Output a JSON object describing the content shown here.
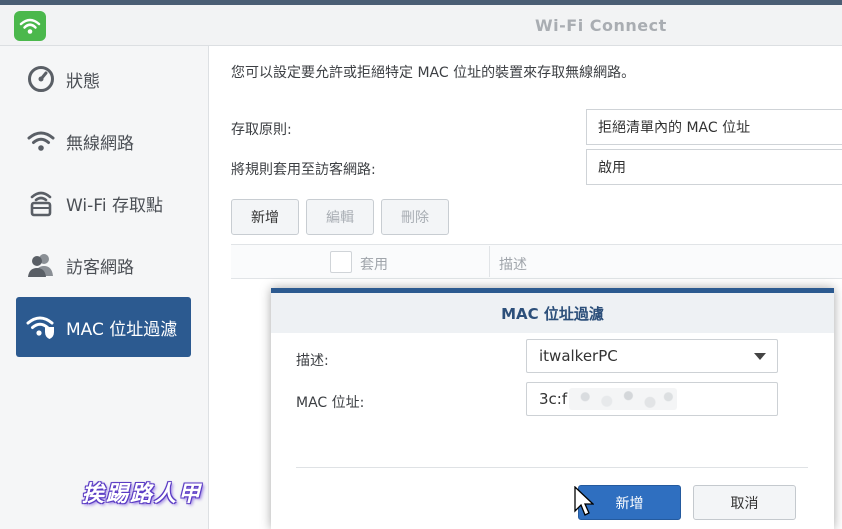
{
  "window": {
    "title": "Wi-Fi Connect"
  },
  "colors": {
    "accent": "#2c5a90",
    "app_icon": "#4bb84c",
    "primary_button": "#2f6fc0"
  },
  "sidebar": {
    "items": [
      {
        "label": "狀態",
        "icon": "dashboard-gauge-icon",
        "active": false
      },
      {
        "label": "無線網路",
        "icon": "wifi-icon",
        "active": false
      },
      {
        "label": "Wi-Fi 存取點",
        "icon": "access-point-icon",
        "active": false
      },
      {
        "label": "訪客網路",
        "icon": "guest-users-icon",
        "active": false
      },
      {
        "label": "MAC 位址過濾",
        "icon": "wifi-shield-icon",
        "active": true
      }
    ]
  },
  "main": {
    "description": "您可以設定要允許或拒絕特定 MAC 位址的裝置來存取無線網路。",
    "access_policy": {
      "label": "存取原則:",
      "value": "拒絕清單內的 MAC 位址"
    },
    "guest_network": {
      "label": "將規則套用至訪客網路:",
      "value": "啟用"
    },
    "toolbar": {
      "add": "新增",
      "edit": "編輯",
      "delete": "刪除"
    },
    "grid": {
      "col_apply": "套用",
      "col_desc": "描述"
    }
  },
  "dialog": {
    "title": "MAC 位址過濾",
    "desc_label": "描述:",
    "desc_value": "itwalkerPC",
    "mac_label": "MAC 位址:",
    "mac_value": "3c:f",
    "ok": "新增",
    "cancel": "取消"
  },
  "watermark": "挨踢路人甲"
}
